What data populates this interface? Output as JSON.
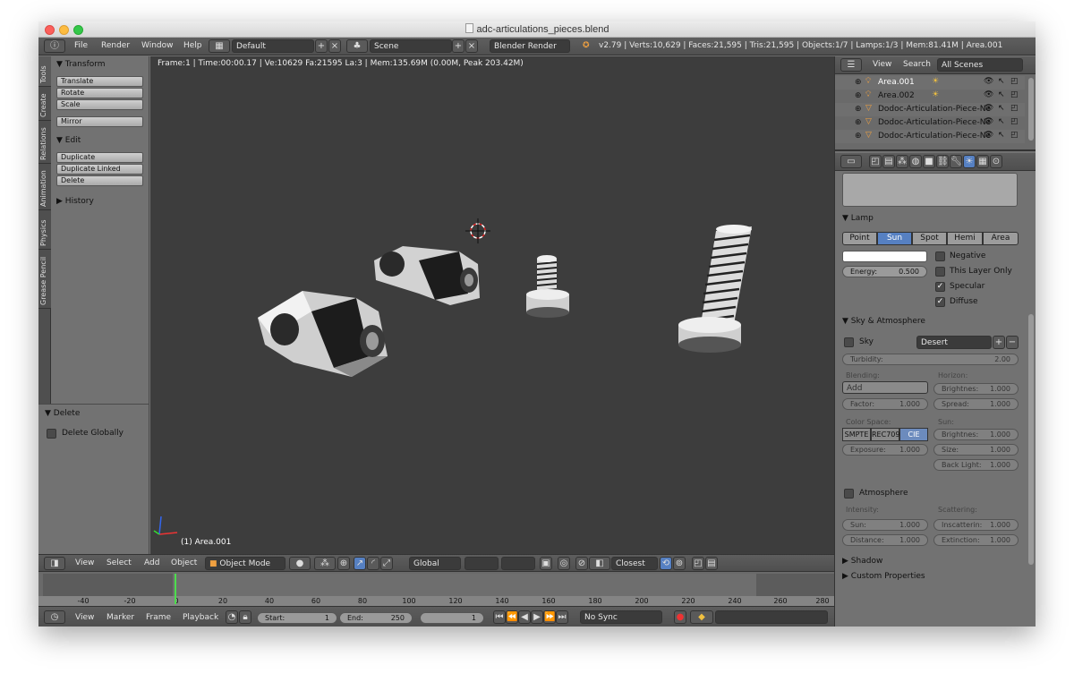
{
  "window": {
    "title": "adc-articulations_pieces.blend"
  },
  "topbar": {
    "menus": [
      "File",
      "Render",
      "Window",
      "Help"
    ],
    "layout": "Default",
    "scene": "Scene",
    "engine": "Blender Render",
    "stats": "v2.79 | Verts:10,629 | Faces:21,595 | Tris:21,595 | Objects:1/7 | Lamps:1/3 | Mem:81.41M | Area.001"
  },
  "tool_tabs": [
    "Tools",
    "Create",
    "Relations",
    "Animation",
    "Physics",
    "Grease Pencil"
  ],
  "tools": {
    "transform_title": "Transform",
    "transform": [
      "Translate",
      "Rotate",
      "Scale",
      "Mirror"
    ],
    "edit_title": "Edit",
    "edit": [
      "Duplicate",
      "Duplicate Linked",
      "Delete"
    ],
    "history_title": "History"
  },
  "operator": {
    "title": "Delete",
    "option": "Delete Globally"
  },
  "viewport": {
    "info": "Frame:1 | Time:00:00.17 | Ve:10629 Fa:21595 La:3 | Mem:135.69M (0.00M, Peak 203.42M)",
    "selected": "(1) Area.001"
  },
  "view3d_header": {
    "menus": [
      "View",
      "Select",
      "Add",
      "Object"
    ],
    "mode": "Object Mode",
    "orientation": "Global",
    "snap": "Closest"
  },
  "timeline": {
    "ticks": [
      "-40",
      "-20",
      "0",
      "20",
      "40",
      "60",
      "80",
      "100",
      "120",
      "140",
      "160",
      "180",
      "200",
      "220",
      "240",
      "260",
      "280"
    ],
    "current_frame_marker": 1,
    "menus": [
      "View",
      "Marker",
      "Frame",
      "Playback"
    ],
    "start_label": "Start:",
    "start": "1",
    "end_label": "End:",
    "end": "250",
    "frame": "1",
    "sync": "No Sync"
  },
  "outliner": {
    "menus": [
      "View",
      "Search"
    ],
    "filter": "All Scenes",
    "items": [
      "Area.001",
      "Area.002",
      "Dodoc-Articulation-Piece-Ne",
      "Dodoc-Articulation-Piece-Ne",
      "Dodoc-Articulation-Piece-Ne"
    ]
  },
  "lamp": {
    "title": "Lamp",
    "types": [
      "Point",
      "Sun",
      "Spot",
      "Hemi",
      "Area"
    ],
    "active_type": "Sun",
    "negative": "Negative",
    "this_layer_only": "This Layer Only",
    "specular": "Specular",
    "diffuse": "Diffuse",
    "energy_label": "Energy:",
    "energy": "0.500",
    "color": "#ffffff"
  },
  "sky": {
    "title": "Sky & Atmosphere",
    "sky_label": "Sky",
    "preset": "Desert",
    "turbidity_label": "Turbidity:",
    "turbidity": "2.00",
    "blending_label": "Blending:",
    "blend_mode": "Add",
    "factor_label": "Factor:",
    "factor": "1.000",
    "horizon_label": "Horizon:",
    "h_brightness_label": "Brightnes:",
    "h_brightness": "1.000",
    "spread_label": "Spread:",
    "spread": "1.000",
    "colorspace_label": "Color Space:",
    "colorspaces": [
      "SMPTE",
      "REC709",
      "CIE"
    ],
    "active_colorspace": "CIE",
    "exposure_label": "Exposure:",
    "exposure": "1.000",
    "sun_label": "Sun:",
    "s_brightness_label": "Brightnes:",
    "s_brightness": "1.000",
    "size_label": "Size:",
    "size": "1.000",
    "backlight_label": "Back Light:",
    "backlight": "1.000"
  },
  "atmosphere": {
    "title": "Atmosphere",
    "intensity_label": "Intensity:",
    "sun_label": "Sun:",
    "sun": "1.000",
    "distance_label": "Distance:",
    "distance": "1.000",
    "scattering_label": "Scattering:",
    "inscatter_label": "Inscatterin:",
    "inscatter": "1.000",
    "extinction_label": "Extinction:",
    "extinction": "1.000"
  },
  "panels": {
    "shadow": "Shadow",
    "custom": "Custom Properties"
  },
  "colors": {
    "accent": "#5680c2",
    "frame_cursor": "#4ddd4d",
    "viewport_bg": "#3d3d3d",
    "panel_bg": "#727272"
  }
}
